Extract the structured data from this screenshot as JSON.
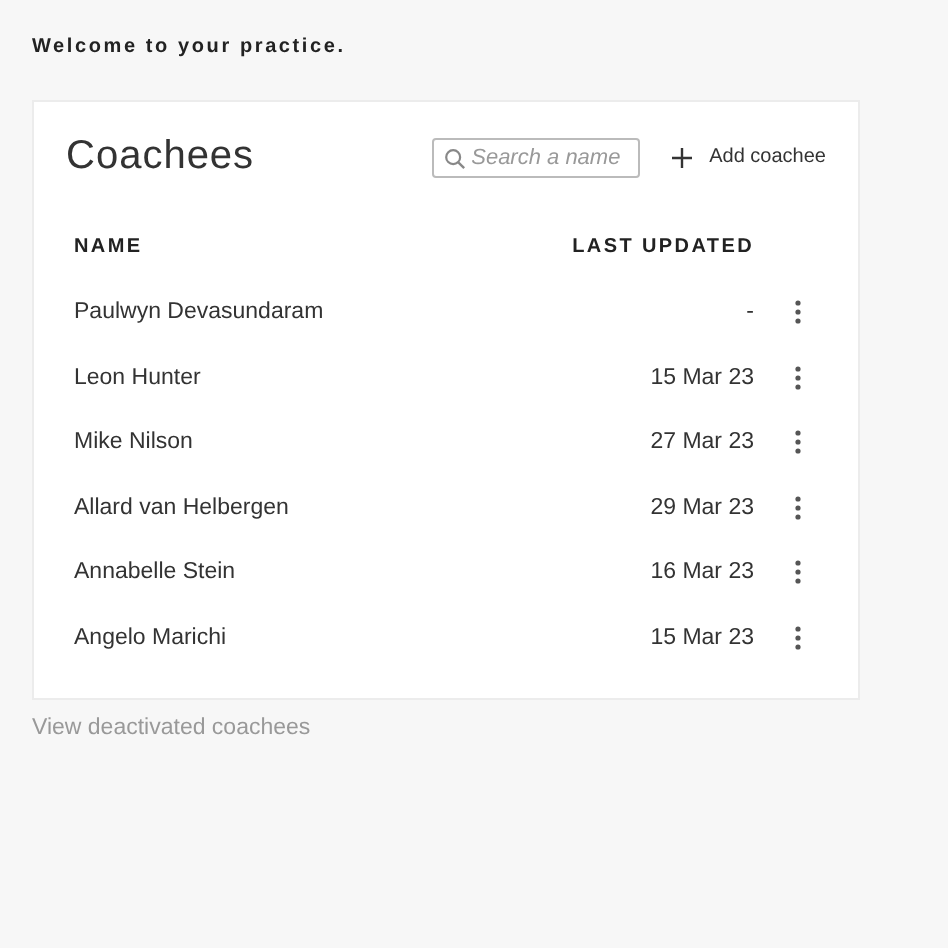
{
  "greeting": "Welcome to your practice.",
  "card": {
    "title": "Coachees",
    "search": {
      "placeholder": "Search a name"
    },
    "add_button": "Add coachee",
    "columns": [
      "NAME",
      "LAST UPDATED"
    ],
    "rows": [
      {
        "name": "Paulwyn Devasundaram",
        "last_updated": "-"
      },
      {
        "name": "Leon Hunter",
        "last_updated": "15 Mar 23"
      },
      {
        "name": "Mike Nilson",
        "last_updated": "27 Mar 23"
      },
      {
        "name": "Allard van Helbergen",
        "last_updated": "29 Mar 23"
      },
      {
        "name": "Annabelle Stein",
        "last_updated": "16 Mar 23"
      },
      {
        "name": "Angelo Marichi",
        "last_updated": "15 Mar 23"
      }
    ]
  },
  "footer_link": "View deactivated coachees"
}
